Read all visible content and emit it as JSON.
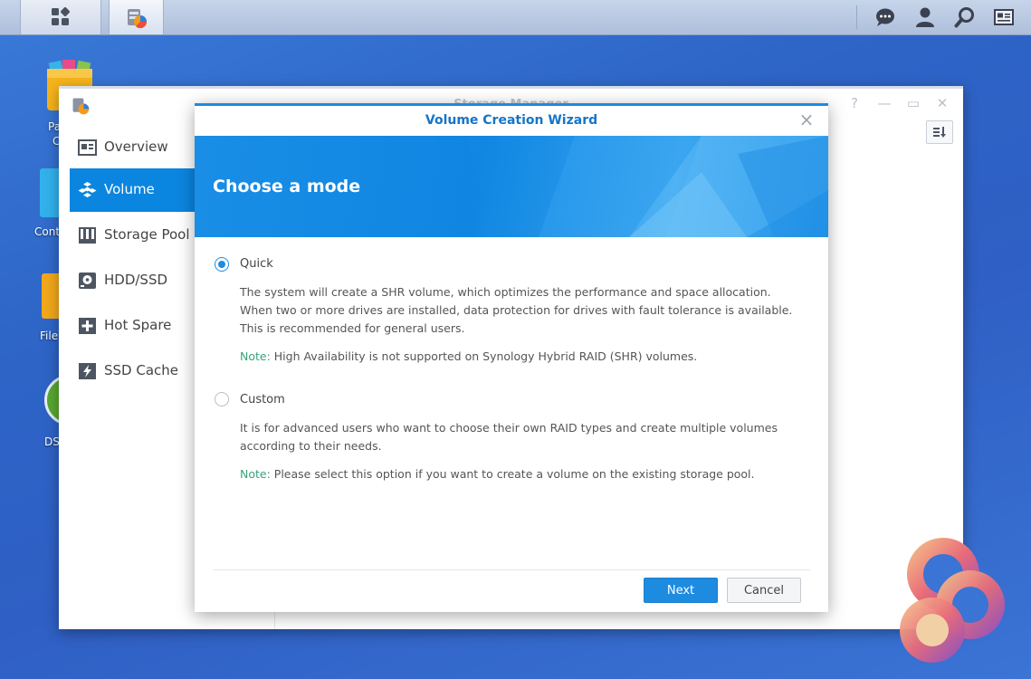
{
  "taskbar": {
    "main_menu_icon": "grid-icon",
    "active_app_icon": "storage-manager-icon",
    "right_icons": [
      "chat-bubble-icon",
      "user-icon",
      "search-icon",
      "widgets-icon"
    ]
  },
  "desktop": {
    "icons": [
      {
        "label": "Pa",
        "label2": "C",
        "icon": "package-center-icon"
      },
      {
        "label": "Cont",
        "icon": "control-panel-icon"
      },
      {
        "label": "File",
        "icon": "file-station-icon"
      },
      {
        "label": "DS",
        "icon": "ds-help-icon"
      }
    ]
  },
  "storage_manager": {
    "title": "Storage Manager",
    "sidebar": {
      "items": [
        {
          "label": "Overview",
          "icon": "overview-icon"
        },
        {
          "label": "Volume",
          "icon": "volume-icon",
          "active": true
        },
        {
          "label": "Storage Pool",
          "icon": "storage-pool-icon"
        },
        {
          "label": "HDD/SSD",
          "icon": "hdd-icon"
        },
        {
          "label": "Hot Spare",
          "icon": "hot-spare-icon"
        },
        {
          "label": "SSD Cache",
          "icon": "ssd-cache-icon"
        }
      ]
    }
  },
  "wizard": {
    "title": "Volume Creation Wizard",
    "banner_title": "Choose a mode",
    "options": [
      {
        "label": "Quick",
        "selected": true,
        "description": "The system will create a SHR volume, which optimizes the performance and space allocation. When two or more drives are installed, data protection for drives with fault tolerance is available. This is recommended for general users.",
        "note_label": "Note:",
        "note_text": " High Availability is not supported on Synology Hybrid RAID (SHR) volumes."
      },
      {
        "label": "Custom",
        "selected": false,
        "description": "It is for advanced users who want to choose their own RAID types and create multiple volumes according to their needs.",
        "note_label": "Note:",
        "note_text": " Please select this option if you want to create a volume on the existing storage pool."
      }
    ],
    "next_label": "Next",
    "cancel_label": "Cancel"
  },
  "colors": {
    "accent": "#1d8be0",
    "note": "#3aa37a",
    "title": "#1575c9"
  }
}
